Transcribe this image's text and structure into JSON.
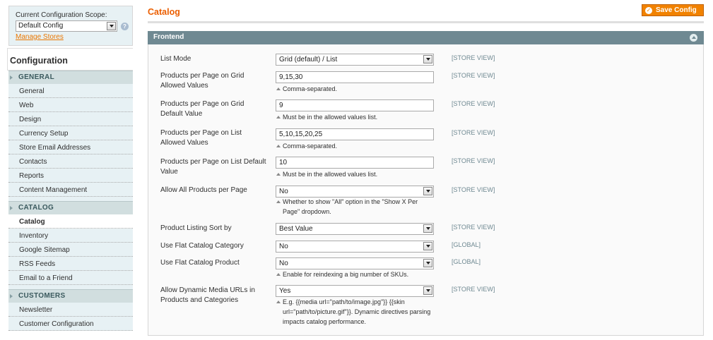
{
  "scope": {
    "label": "Current Configuration Scope:",
    "selected": "Default Config",
    "manage_link": "Manage Stores"
  },
  "sidebar": {
    "title": "Configuration",
    "sections": [
      {
        "title": "GENERAL",
        "items": [
          "General",
          "Web",
          "Design",
          "Currency Setup",
          "Store Email Addresses",
          "Contacts",
          "Reports",
          "Content Management"
        ]
      },
      {
        "title": "CATALOG",
        "items": [
          "Catalog",
          "Inventory",
          "Google Sitemap",
          "RSS Feeds",
          "Email to a Friend"
        ]
      },
      {
        "title": "CUSTOMERS",
        "items": [
          "Newsletter",
          "Customer Configuration"
        ]
      }
    ],
    "active_item": "Catalog"
  },
  "page": {
    "title": "Catalog",
    "save_label": "Save Config"
  },
  "fieldset": {
    "title": "Frontend",
    "fields": [
      {
        "label": "List Mode",
        "type": "select",
        "value": "Grid (default) / List",
        "scope": "[STORE VIEW]",
        "note": ""
      },
      {
        "label": "Products per Page on Grid Allowed Values",
        "type": "text",
        "value": "9,15,30",
        "scope": "[STORE VIEW]",
        "note": "Comma-separated."
      },
      {
        "label": "Products per Page on Grid Default Value",
        "type": "text",
        "value": "9",
        "scope": "[STORE VIEW]",
        "note": "Must be in the allowed values list."
      },
      {
        "label": "Products per Page on List Allowed Values",
        "type": "text",
        "value": "5,10,15,20,25",
        "scope": "[STORE VIEW]",
        "note": "Comma-separated."
      },
      {
        "label": "Products per Page on List Default Value",
        "type": "text",
        "value": "10",
        "scope": "[STORE VIEW]",
        "note": "Must be in the allowed values list."
      },
      {
        "label": "Allow All Products per Page",
        "type": "select",
        "value": "No",
        "scope": "[STORE VIEW]",
        "note": "Whether to show \"All\" option in the \"Show X Per Page\" dropdown."
      },
      {
        "label": "Product Listing Sort by",
        "type": "select",
        "value": "Best Value",
        "scope": "[STORE VIEW]",
        "note": ""
      },
      {
        "label": "Use Flat Catalog Category",
        "type": "select",
        "value": "No",
        "scope": "[GLOBAL]",
        "note": ""
      },
      {
        "label": "Use Flat Catalog Product",
        "type": "select",
        "value": "No",
        "scope": "[GLOBAL]",
        "note": "Enable for reindexing a big number of SKUs."
      },
      {
        "label": "Allow Dynamic Media URLs in Products and Categories",
        "type": "select",
        "value": "Yes",
        "scope": "[STORE VIEW]",
        "note": "E.g. {{media url=\"path/to/image.jpg\"}} {{skin url=\"path/to/picture.gif\"}}. Dynamic directives parsing impacts catalog performance."
      }
    ]
  },
  "colors": {
    "accent": "#eb5e00",
    "button": "#f18200",
    "fieldset_header": "#6f8992",
    "sidebar_bg": "#e7f1f4",
    "section_head": "#d1dedf"
  }
}
